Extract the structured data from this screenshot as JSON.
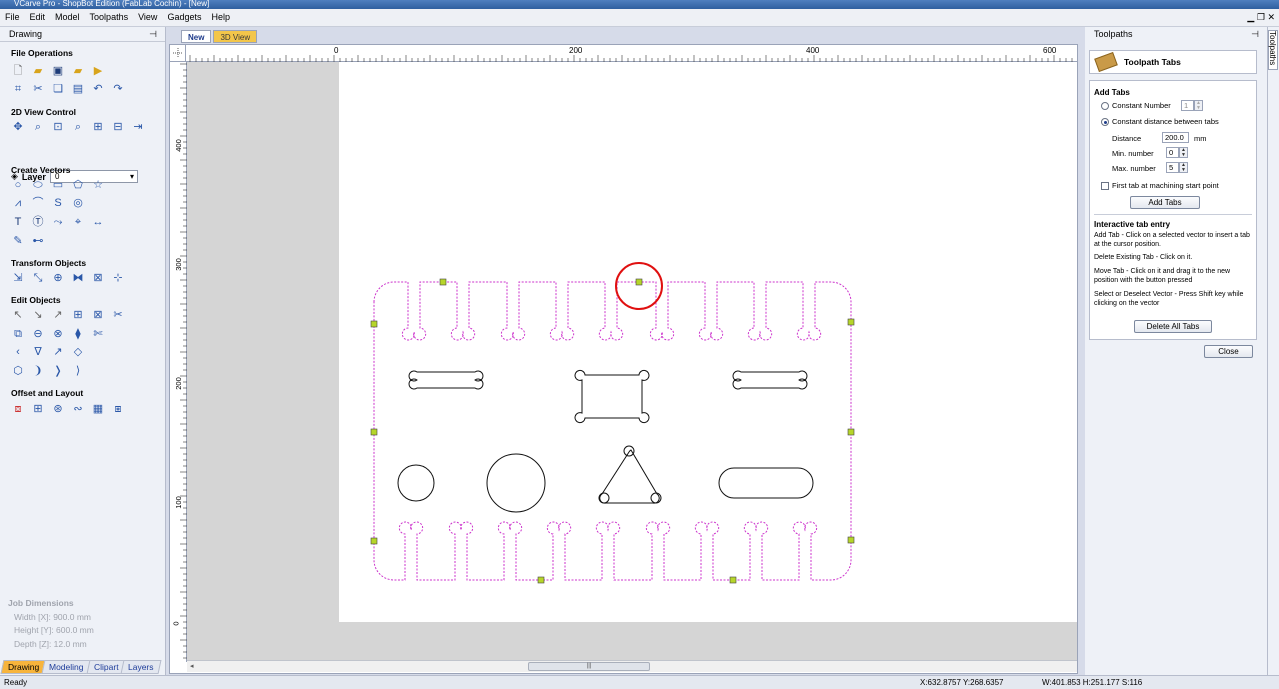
{
  "window": {
    "title": "VCarve Pro - ShopBot Edition (FabLab Cochin) - [New]"
  },
  "menu": [
    "File",
    "Edit",
    "Model",
    "Toolpaths",
    "View",
    "Gadgets",
    "Help"
  ],
  "left_panel": {
    "title": "Drawing",
    "sections": {
      "file": "File Operations",
      "view": "2D View Control",
      "create": "Create Vectors",
      "transform": "Transform Objects",
      "edit": "Edit Objects",
      "offset": "Offset and Layout"
    },
    "layer_label": "Layer",
    "layer_value": "0",
    "job": {
      "heading": "Job Dimensions",
      "width": "Width  [X]: 900.0 mm",
      "height": "Height [Y]: 600.0 mm",
      "depth": "Depth  [Z]: 12.0 mm"
    },
    "tabs": [
      "Drawing",
      "Modeling",
      "Clipart",
      "Layers"
    ]
  },
  "doc_tabs": [
    "New",
    "3D View"
  ],
  "ruler": {
    "top": [
      "0",
      "200",
      "400",
      "600"
    ],
    "left": [
      "400",
      "300",
      "200",
      "100",
      "0"
    ]
  },
  "right_panel": {
    "title": "Toolpaths",
    "vertical_tab": "Toolpaths",
    "card_title": "Toolpath Tabs",
    "add_tabs_heading": "Add Tabs",
    "constant_number": "Constant Number",
    "constant_number_value": "1",
    "constant_distance": "Constant distance between tabs",
    "distance_label": "Distance",
    "distance_value": "200.0",
    "distance_unit": "mm",
    "min_label": "Min. number",
    "min_value": "0",
    "max_label": "Max. number",
    "max_value": "5",
    "first_tab": "First tab at machining start point",
    "add_tabs_button": "Add Tabs",
    "interactive_heading": "Interactive tab entry",
    "help1": "Add Tab - Click on a selected vector to insert a tab at the cursor position.",
    "help2": "Delete Existing Tab - Click on it.",
    "help3": "Move Tab - Click on it and drag it to the new position with the button pressed",
    "help4": "Select or Deselect Vector - Press Shift key while clicking on the vector",
    "delete_button": "Delete All Tabs",
    "close_button": "Close"
  },
  "status": {
    "left": "Ready",
    "coords": "X:632.8757 Y:268.6357",
    "dims": "W:401.853  H:251.177  S:116"
  },
  "colors": {
    "accent": "#f7b43c",
    "selection": "#cc33cc",
    "highlight_circle": "#e01010",
    "tab_marker": "#b6d52a"
  }
}
